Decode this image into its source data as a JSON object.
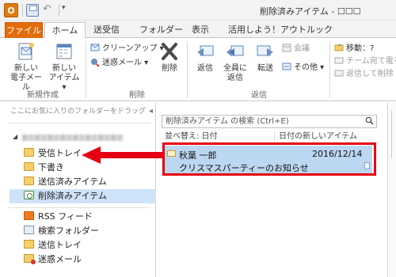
{
  "app": {
    "icon_letter": "O"
  },
  "window": {
    "title": "削除済みアイテム - ☐☐☐"
  },
  "tabs": [
    {
      "label": "ファイル"
    },
    {
      "label": "ホーム"
    },
    {
      "label": "送受信"
    },
    {
      "label": "フォルダー"
    },
    {
      "label": "表示"
    },
    {
      "label": "活用しよう！アウトルック"
    }
  ],
  "ribbon": {
    "new_group": {
      "label": "新規作成",
      "new_email": "新しい\n電子メール",
      "new_items": "新しい\nアイテム ▾"
    },
    "delete_group": {
      "label": "削除",
      "cleanup": "クリーンアップ ▾",
      "junk": "迷惑メール ▾",
      "delete": "削除"
    },
    "reply_group": {
      "label": "返信",
      "reply": "返信",
      "reply_all": "全員に\n返信",
      "forward": "転送",
      "meeting": "会議",
      "more": "その他 ▾"
    },
    "quick_group": {
      "move": "移動：?",
      "to_manager": "チーム宛て電子",
      "reply_delete": "返信して削除"
    }
  },
  "folder_pane": {
    "fav_drop_hint": "ここにお気に入りのフォルダーをドラッグ",
    "items": [
      {
        "label": "受信トレイ",
        "icon": "inbox-folder-icon"
      },
      {
        "label": "下書き",
        "icon": "drafts-folder-icon"
      },
      {
        "label": "送信済みアイテム",
        "icon": "sent-folder-icon"
      },
      {
        "label": "削除済みアイテム",
        "icon": "deleted-items-icon"
      },
      {
        "label": "RSS フィード",
        "icon": "rss-icon"
      },
      {
        "label": "検索フォルダー",
        "icon": "search-folder-icon"
      },
      {
        "label": "送信トレイ",
        "icon": "outbox-icon"
      },
      {
        "label": "迷惑メール",
        "icon": "junk-mail-icon"
      }
    ]
  },
  "message_list": {
    "search_placeholder": "削除済みアイテム の検索 (Ctrl+E)",
    "sort_label": "並べ替え: 日付",
    "order_label": "日付の新しいアイテム",
    "messages": [
      {
        "sender": "秋葉 一郎",
        "date": "2016/12/14",
        "subject": "クリスマスパーティーのお知らせ"
      }
    ]
  },
  "annotation": {
    "arrow_color": "#e60012",
    "box_color": "#e60012"
  },
  "colors": {
    "file_tab": "#e36c0a",
    "selection": "#cfe3f8",
    "message_selected": "#bcd7f1"
  }
}
